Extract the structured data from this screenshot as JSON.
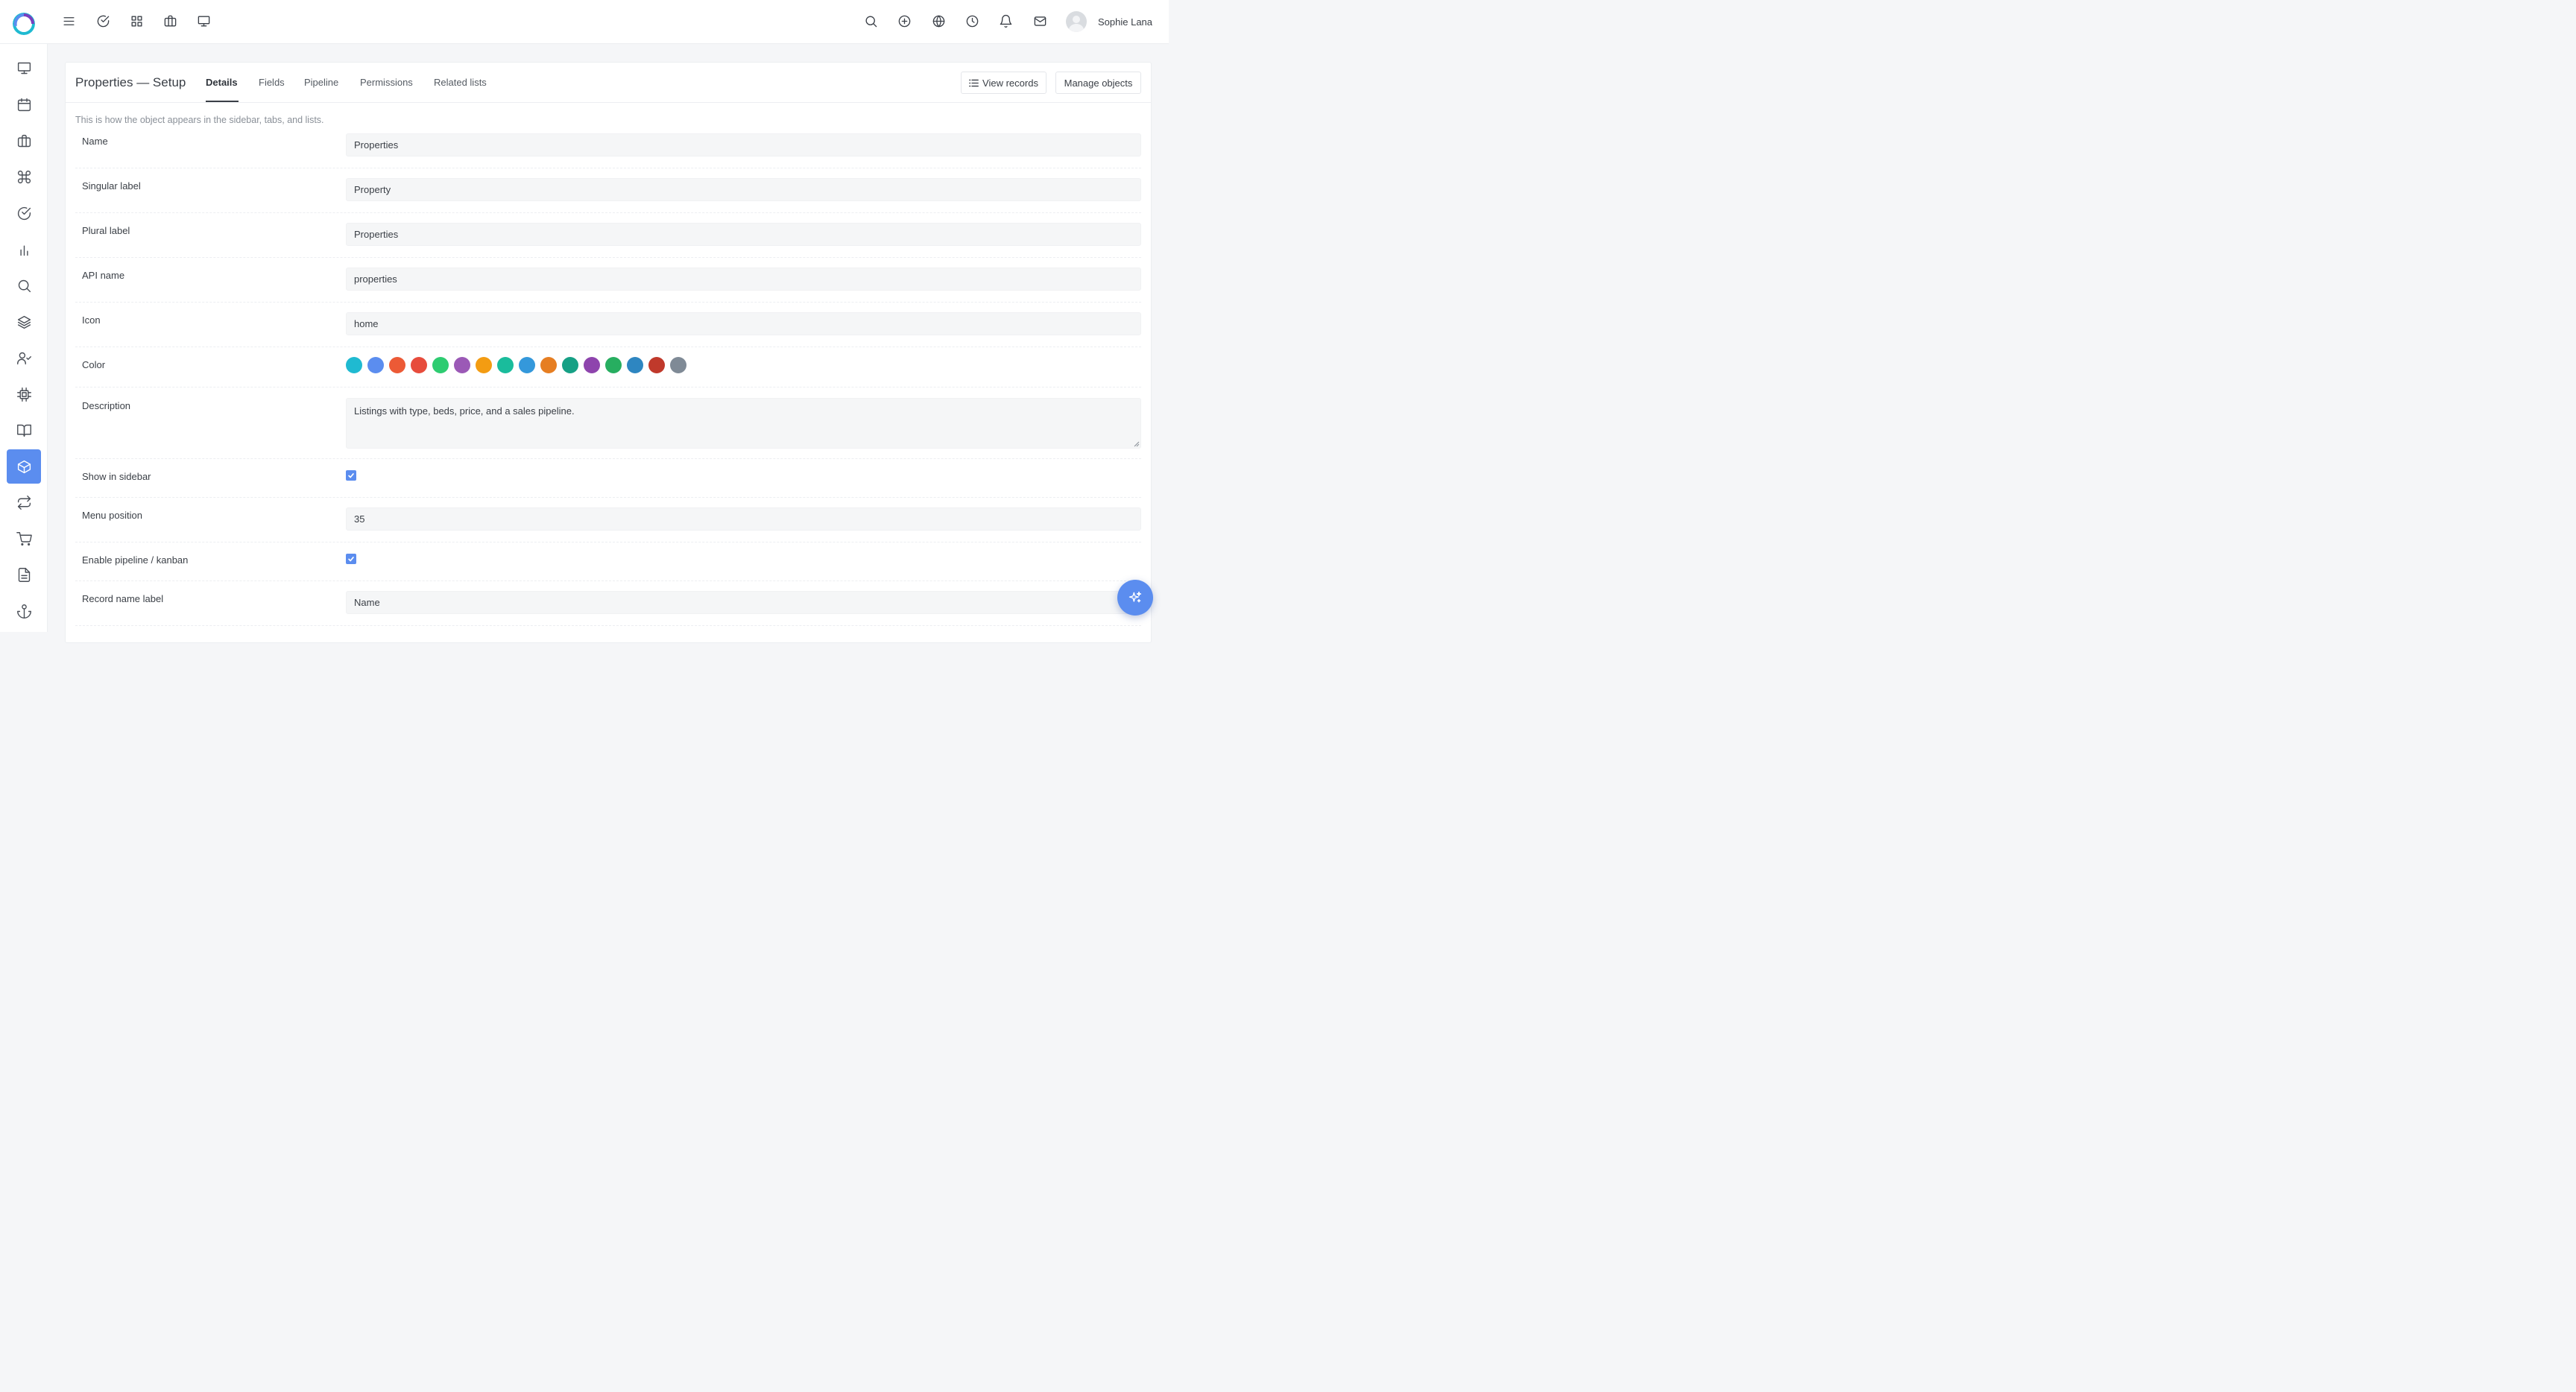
{
  "topbar": {
    "left_icons": [
      "menu-icon",
      "check-circle-icon",
      "grid-icon",
      "briefcase-icon",
      "monitor-icon"
    ],
    "right_icons": [
      "search-icon",
      "plus-circle-icon",
      "globe-icon",
      "clock-icon",
      "bell-icon",
      "mail-icon"
    ],
    "user_name": "Sophie Lana"
  },
  "sidebar": {
    "items": [
      {
        "icon": "monitor-icon"
      },
      {
        "icon": "calendar-icon"
      },
      {
        "icon": "briefcase-icon"
      },
      {
        "icon": "command-icon"
      },
      {
        "icon": "check-circle-icon"
      },
      {
        "icon": "bar-chart-icon"
      },
      {
        "icon": "search-icon"
      },
      {
        "icon": "layers-icon"
      },
      {
        "icon": "user-check-icon"
      },
      {
        "icon": "cpu-icon"
      },
      {
        "icon": "book-open-icon"
      },
      {
        "icon": "box-icon",
        "active": true
      },
      {
        "icon": "repeat-icon"
      },
      {
        "icon": "cart-icon"
      },
      {
        "icon": "file-text-icon"
      },
      {
        "icon": "anchor-icon"
      }
    ]
  },
  "card": {
    "title": "Properties — Setup",
    "tabs": [
      {
        "label": "Details",
        "active": true
      },
      {
        "label": "Fields"
      },
      {
        "label": "Pipeline"
      },
      {
        "label": "Permissions"
      },
      {
        "label": "Related lists"
      }
    ],
    "view_records_label": "View records",
    "manage_objects_label": "Manage objects",
    "hint": "This is how the object appears in the sidebar, tabs, and lists."
  },
  "form": {
    "name": {
      "label": "Name",
      "value": "Properties"
    },
    "singular": {
      "label": "Singular label",
      "value": "Property"
    },
    "plural": {
      "label": "Plural label",
      "value": "Properties"
    },
    "api": {
      "label": "API name",
      "value": "properties"
    },
    "icon": {
      "label": "Icon",
      "value": "home"
    },
    "color": {
      "label": "Color",
      "swatches": [
        "#1fbad1",
        "#5b8def",
        "#ec5a36",
        "#e74c3c",
        "#2ecc71",
        "#9b59b6",
        "#f39c12",
        "#1abc9c",
        "#3498db",
        "#e67e22",
        "#16a085",
        "#8e44ad",
        "#27ae60",
        "#2e86c1",
        "#c0392b",
        "#7f8a96"
      ]
    },
    "description": {
      "label": "Description",
      "value": "Listings with type, beds, price, and a sales pipeline."
    },
    "show_in_sidebar": {
      "label": "Show in sidebar",
      "checked": true
    },
    "menu_position": {
      "label": "Menu position",
      "value": "35"
    },
    "enable_pipeline": {
      "label": "Enable pipeline / kanban",
      "checked": true
    },
    "record_name_label": {
      "label": "Record name label",
      "value": "Name"
    }
  },
  "fab": {
    "icon": "sparkles-icon"
  }
}
